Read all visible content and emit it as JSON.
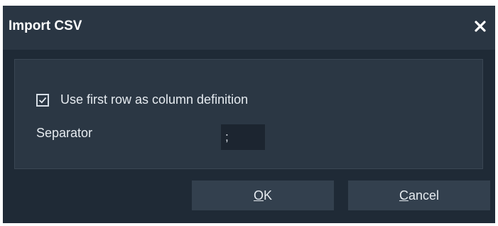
{
  "dialog": {
    "title": "Import CSV",
    "close_icon": "close-icon"
  },
  "options": {
    "use_first_row": {
      "label": "Use first row as column definition",
      "checked": true
    },
    "separator": {
      "label": "Separator",
      "value": ";"
    }
  },
  "buttons": {
    "ok": {
      "mnemonic": "O",
      "rest": "K"
    },
    "cancel": {
      "mnemonic": "C",
      "rest": "ancel"
    }
  },
  "colors": {
    "dialog_bg": "#1f2a36",
    "titlebar_bg": "#2a3643",
    "panel_bg": "#2b3744",
    "button_bg": "#33404e",
    "text": "#e6ebf0"
  }
}
